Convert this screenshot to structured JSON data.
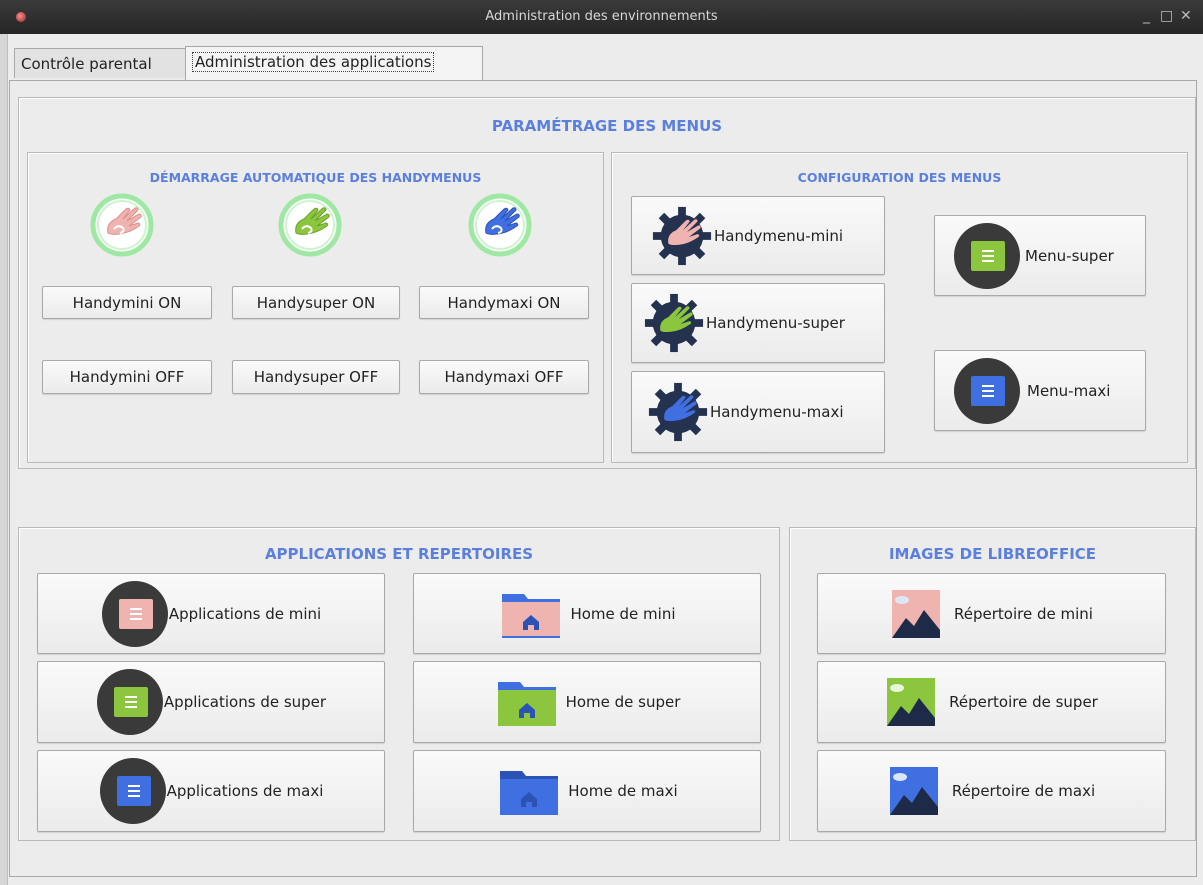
{
  "window": {
    "title": "Administration des environnements",
    "controls": [
      "_",
      "□",
      "✕"
    ]
  },
  "tabs": [
    {
      "label": "Contrôle parental",
      "active": false
    },
    {
      "label": "Administration des applications",
      "active": true
    }
  ],
  "menus_section": {
    "title": "PARAMÉTRAGE DES MENUS",
    "autostart": {
      "title": "DÉMARRAGE AUTOMATIQUE DES HANDYMENUS",
      "icons": [
        "hand-mini-icon",
        "hand-super-icon",
        "hand-maxi-icon"
      ],
      "on_buttons": [
        "Handymini ON",
        "Handysuper ON",
        "Handymaxi ON"
      ],
      "off_buttons": [
        "Handymini OFF",
        "Handysuper OFF",
        "Handymaxi OFF"
      ]
    },
    "config": {
      "title": "CONFIGURATION DES MENUS",
      "handy_buttons": [
        "Handymenu-mini",
        "Handymenu-super",
        "Handymenu-maxi"
      ],
      "menu_buttons": [
        "Menu-super",
        "Menu-maxi"
      ]
    }
  },
  "apps_section": {
    "title": "APPLICATIONS ET REPERTOIRES",
    "app_buttons": [
      "Applications de mini",
      "Applications de super",
      "Applications de maxi"
    ],
    "home_buttons": [
      "Home de mini",
      "Home de super",
      "Home de maxi"
    ]
  },
  "images_section": {
    "title": "IMAGES DE LIBREOFFICE",
    "buttons": [
      "Répertoire de mini",
      "Répertoire de super",
      "Répertoire de maxi"
    ]
  },
  "colors": {
    "mini": "#f0b4b0",
    "super": "#8cc63f",
    "maxi": "#3f6fe0",
    "header_blue": "#5b7fdd",
    "dark_circle": "#3a3a3a"
  }
}
